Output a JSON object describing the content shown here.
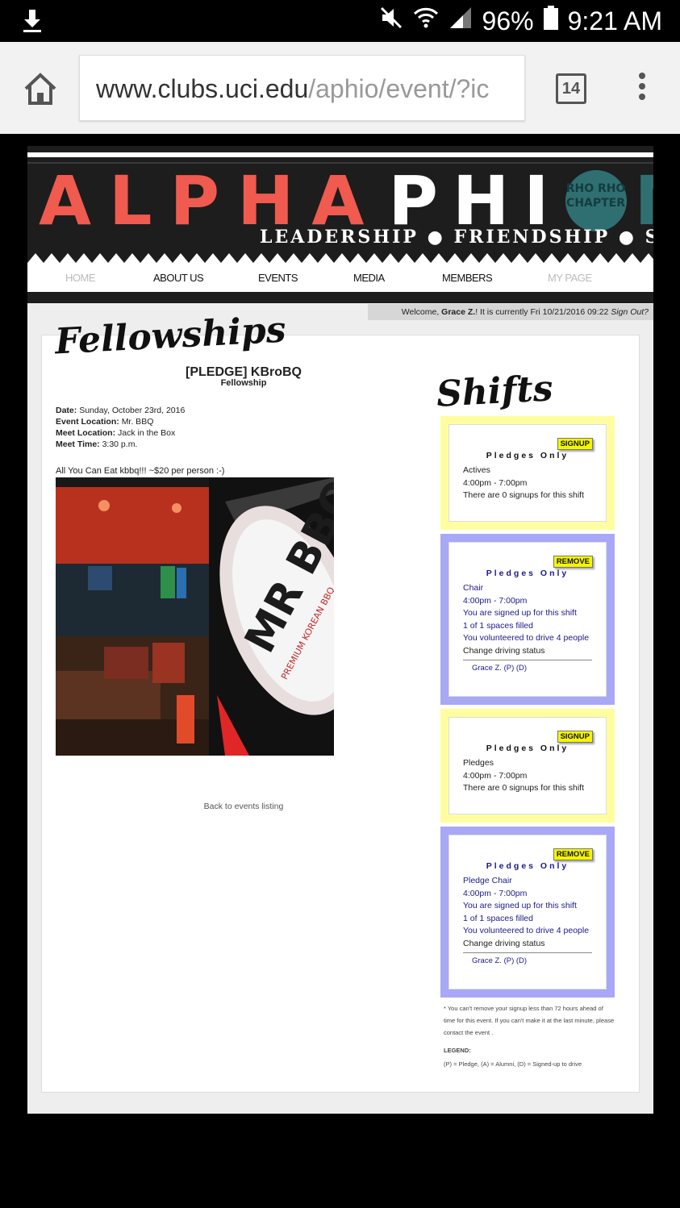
{
  "status_bar": {
    "battery": "96%",
    "time": "9:21 AM"
  },
  "browser": {
    "url_host": "www.clubs.uci.edu",
    "url_path": "/aphio/event/?ic",
    "tab_count": "14"
  },
  "site": {
    "logo_alpha": "ALPHA",
    "logo_phi": "PHI",
    "logo_chapter": "RHO RHO CHAPTER",
    "logo_mega": "MEGA",
    "tagline": "LEADERSHIP ● FRIENDSHIP ● SERVICE",
    "nav": [
      "HOME",
      "ABOUT US",
      "EVENTS",
      "MEDIA",
      "MEMBERS",
      "MY PAGE"
    ],
    "welcome_prefix": "Welcome, ",
    "welcome_name": "Grace Z.",
    "welcome_middle": "! It is currently Fri 10/21/2016 09:22 ",
    "sign_out": "Sign Out?"
  },
  "event": {
    "section_title": "Fellowships",
    "title": "[PLEDGE] KBroBQ",
    "subtitle": "Fellowship",
    "date_label": "Date:",
    "date": "Sunday, October 23rd, 2016",
    "location_label": "Event Location:",
    "location": "Mr. BBQ",
    "meet_location_label": "Meet Location:",
    "meet_location": "Jack in the Box",
    "meet_time_label": "Meet Time:",
    "meet_time": "3:30 p.m.",
    "description": "All You Can Eat kbbq!!! ~$20 per person :-)",
    "photo_sign": "MR BBQ",
    "photo_sign_sub": "PREMIUM KOREAN BBQ",
    "back_link": "Back to events listing"
  },
  "shifts": {
    "section_title": "Shifts",
    "items": [
      {
        "button": "SIGNUP",
        "heading": "Pledges Only",
        "role": "Actives",
        "time": "4:00pm - 7:00pm",
        "info": "There are 0 signups for this shift"
      },
      {
        "button": "REMOVE",
        "heading": "Pledges Only",
        "role": "Chair",
        "time": "4:00pm - 7:00pm",
        "signed": "You are signed up for this shift",
        "filled": "1 of 1 spaces filled",
        "drive": "You volunteered to drive 4 people",
        "change": "Change driving status",
        "member": "Grace Z. (P) (D)"
      },
      {
        "button": "SIGNUP",
        "heading": "Pledges Only",
        "role": "Pledges",
        "time": "4:00pm - 7:00pm",
        "info": "There are 0 signups for this shift"
      },
      {
        "button": "REMOVE",
        "heading": "Pledges Only",
        "role": "Pledge Chair",
        "time": "4:00pm - 7:00pm",
        "signed": "You are signed up for this shift",
        "filled": "1 of 1 spaces filled",
        "drive": "You volunteered to drive 4 people",
        "change": "Change driving status",
        "member": "Grace Z. (P) (D)"
      }
    ],
    "footnote": "* You can't remove your signup less than 72 hours ahead of time for this event. If you can't make it at the last minute, please contact the event .",
    "legend_title": "LEGEND:",
    "legend_text": "(P) = Pledge, (A) = Alumni, (D) = Signed-up to drive"
  },
  "colors": {
    "alpha_red": "#f05a4f",
    "mega_teal": "#2f6f72",
    "shift_yellow": "#fefea0",
    "shift_purple": "#a8a8f6",
    "button_yellow": "#f5f500"
  }
}
